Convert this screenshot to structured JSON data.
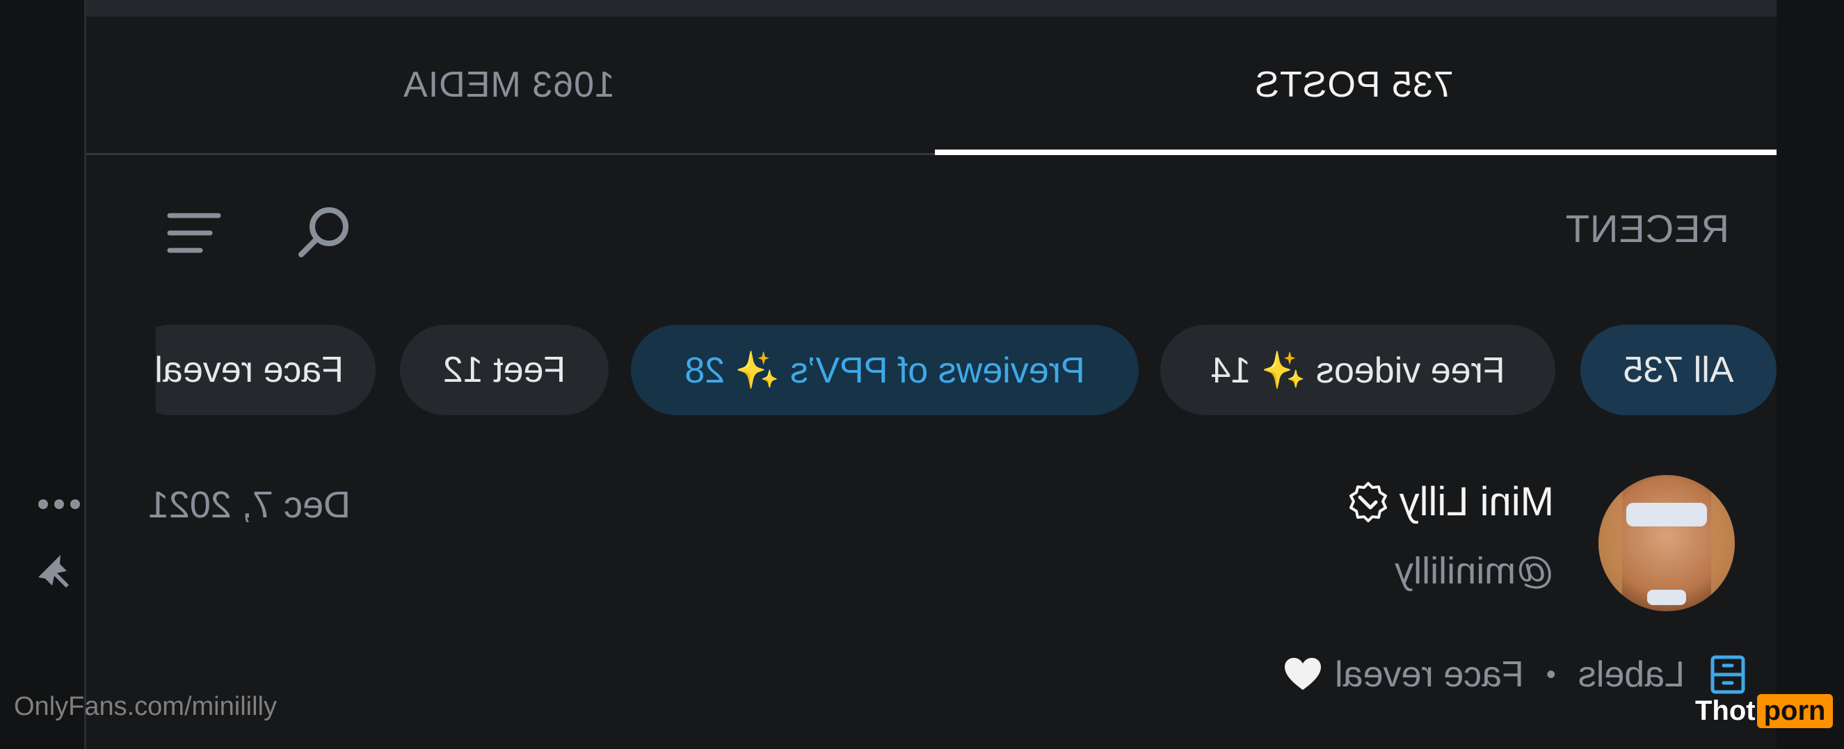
{
  "tabs": [
    {
      "label": "735 POSTS",
      "active": true
    },
    {
      "label": "1063 MEDIA",
      "active": false
    }
  ],
  "feed": {
    "sort_label": "RECENT",
    "icons": [
      "search-icon",
      "filter-icon"
    ]
  },
  "chips": [
    {
      "label": "All 735",
      "style": "active"
    },
    {
      "label": "Free videos ✨ 14",
      "style": "dark"
    },
    {
      "label": "Previews of PPV’s ✨ 28",
      "style": "ppv"
    },
    {
      "label": "Feet 12",
      "style": "dark"
    },
    {
      "label": "Face reveal",
      "style": "dark"
    }
  ],
  "post": {
    "author_name": "Mini Lilly",
    "author_handle": "@minililly",
    "date": "Dec 7, 2021",
    "labels_label": "Labels",
    "label_tag": "Face reveal"
  },
  "watermark": "OnlyFans.com/minililly",
  "brand": {
    "part1": "Thot",
    "part2": "porn"
  },
  "colors": {
    "background": "#121315",
    "panel": "#17181a",
    "accent_blue": "#3fa9e8",
    "active_chip": "#1a3950",
    "brand_orange": "#ff9000"
  }
}
